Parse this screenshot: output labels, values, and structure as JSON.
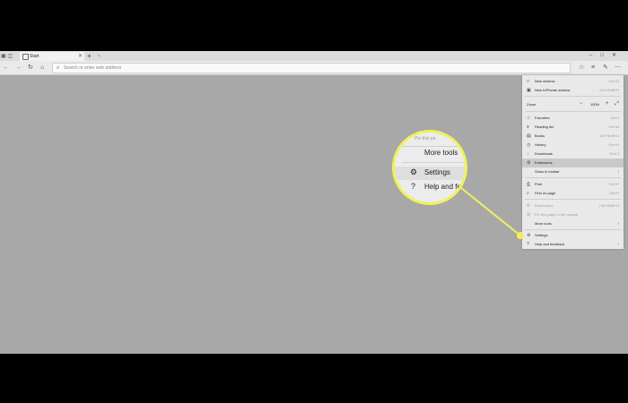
{
  "tab": {
    "title": "Start"
  },
  "toolbar": {
    "address_placeholder": "Search or enter web address"
  },
  "menu": {
    "items": [
      {
        "icon": "□",
        "label": "New window",
        "shortcut": "Ctrl+N"
      },
      {
        "icon": "▣",
        "label": "New InPrivate window",
        "shortcut": "Ctrl+Shift+P"
      },
      {
        "label": "Zoom",
        "value": "100%"
      },
      {
        "icon": "☆",
        "label": "Favorites",
        "shortcut": "Ctrl+I"
      },
      {
        "icon": "≡",
        "label": "Reading list",
        "shortcut": "Ctrl+M"
      },
      {
        "icon": "▤",
        "label": "Books",
        "shortcut": "Ctrl+Shift+U"
      },
      {
        "icon": "◷",
        "label": "History",
        "shortcut": "Ctrl+H"
      },
      {
        "icon": "↓",
        "label": "Downloads",
        "shortcut": "Ctrl+J"
      },
      {
        "icon": "⚙",
        "label": "Extensions"
      },
      {
        "label": "Show in toolbar"
      },
      {
        "icon": "⎙",
        "label": "Print",
        "shortcut": "Ctrl+P"
      },
      {
        "icon": "⌕",
        "label": "Find on page",
        "shortcut": "Ctrl+F"
      },
      {
        "icon": "A",
        "label": "Read aloud",
        "shortcut": "Ctrl+Shift+G"
      },
      {
        "icon": "⊞",
        "label": "Pin this page to the taskbar"
      },
      {
        "label": "More tools"
      },
      {
        "icon": "⚙",
        "label": "Settings"
      },
      {
        "icon": "?",
        "label": "Help and feedback"
      }
    ]
  },
  "callout": {
    "top_text": "Pin this pa",
    "more_tools": "More tools",
    "settings": "Settings",
    "help": "Help and fe"
  },
  "colors": {
    "highlight": "#f3f05a",
    "screen_bg": "#a8a8a8",
    "menu_bg": "#e9e9e9"
  }
}
